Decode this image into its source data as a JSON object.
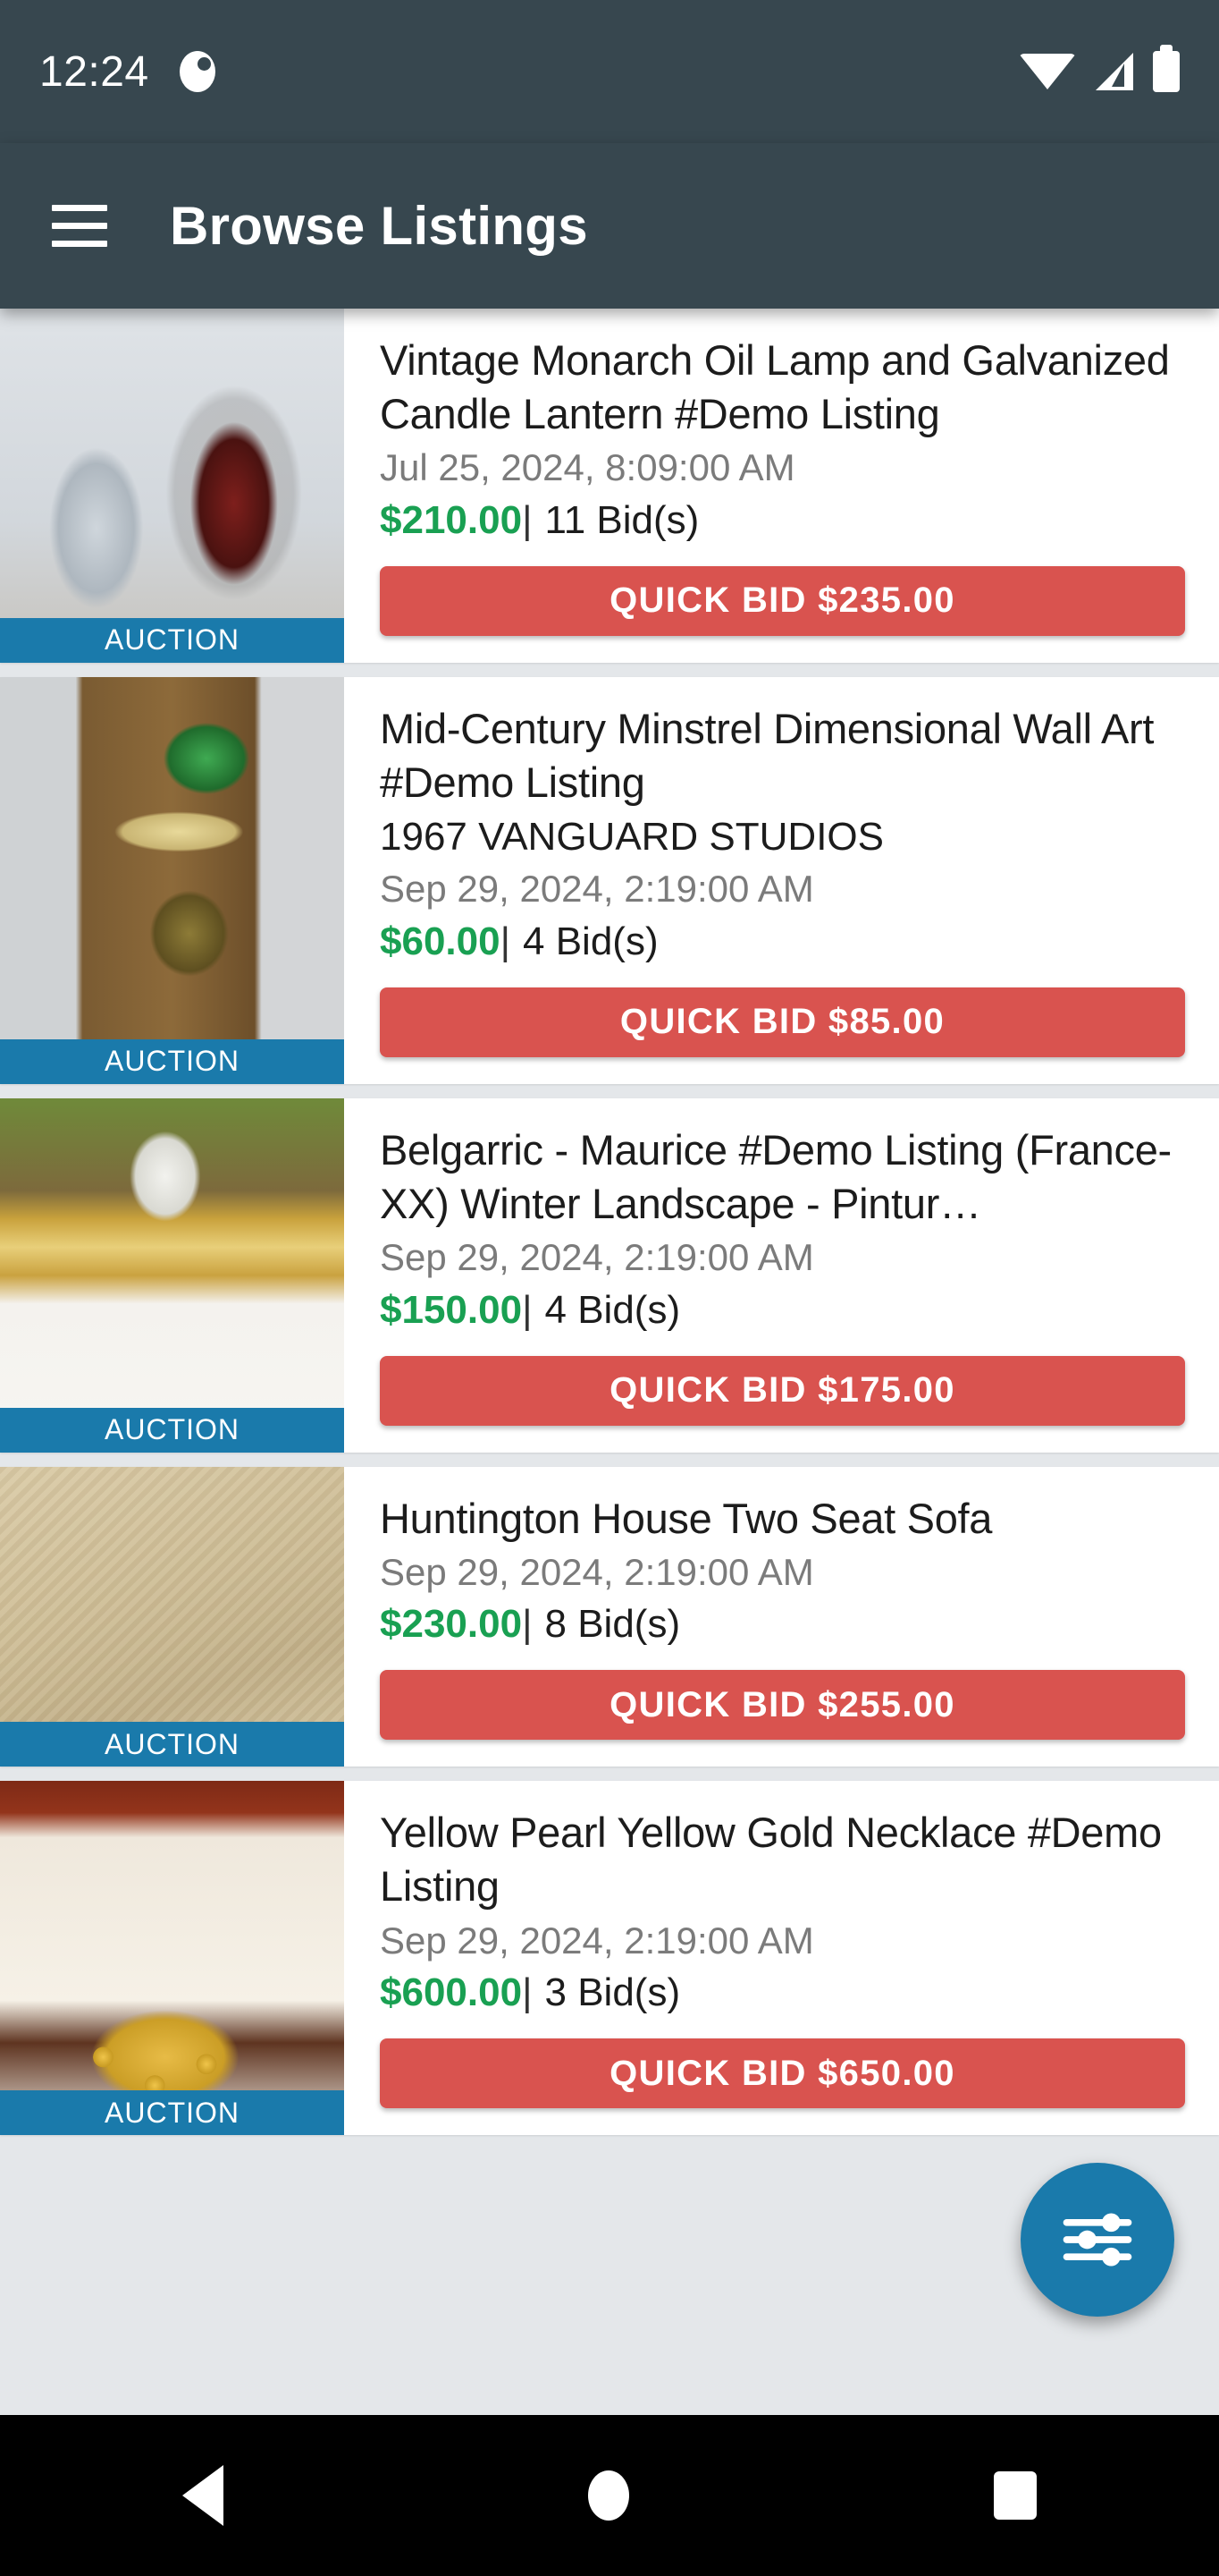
{
  "status_bar": {
    "clock": "12:24",
    "icons": [
      "notification-icon",
      "wifi-icon",
      "cell-signal-icon",
      "battery-icon"
    ]
  },
  "app_bar": {
    "menu_icon": "hamburger-menu-icon",
    "title": "Browse Listings"
  },
  "listings": [
    {
      "title": "Vintage Monarch Oil Lamp and Galvanized Candle Lantern #Demo Listing",
      "subtitle": "",
      "date": "Jul 25, 2024, 8:09:00 AM",
      "price": "$210.00",
      "separator": "|",
      "bids": "11 Bid(s)",
      "bid_button": "QUICK BID $235.00",
      "badge": "AUCTION",
      "image": "vintage-oil-lamp-photo"
    },
    {
      "title": "Mid-Century Minstrel Dimensional Wall Art #Demo Listing",
      "subtitle": "1967 VANGUARD STUDIOS",
      "date": "Sep 29, 2024, 2:19:00 AM",
      "price": "$60.00",
      "separator": "|",
      "bids": "4 Bid(s)",
      "bid_button": "QUICK BID $85.00",
      "badge": "AUCTION",
      "image": "wall-art-photo"
    },
    {
      "title": "Belgarric - Maurice #Demo Listing (France- XX) Winter Landscape - Pintur…",
      "subtitle": "",
      "date": "Sep 29, 2024, 2:19:00 AM",
      "price": "$150.00",
      "separator": "|",
      "bids": "4 Bid(s)",
      "bid_button": "QUICK BID $175.00",
      "badge": "AUCTION",
      "image": "gold-picture-frame-photo"
    },
    {
      "title": "Huntington House Two Seat Sofa",
      "subtitle": "",
      "date": "Sep 29, 2024, 2:19:00 AM",
      "price": "$230.00",
      "separator": "|",
      "bids": "8 Bid(s)",
      "bid_button": "QUICK BID $255.00",
      "badge": "AUCTION",
      "image": "beige-sofa-photo"
    },
    {
      "title": "Yellow Pearl Yellow Gold Necklace #Demo Listing",
      "subtitle": "",
      "date": "Sep 29, 2024, 2:19:00 AM",
      "price": "$600.00",
      "separator": "|",
      "bids": "3 Bid(s)",
      "bid_button": "QUICK BID $650.00",
      "badge": "AUCTION",
      "image": "pearl-necklace-photo"
    }
  ],
  "fab": {
    "icon": "filter-tune-icon"
  },
  "nav_bar": {
    "back": "back-icon",
    "home": "home-icon",
    "recents": "recents-icon"
  },
  "colors": {
    "app_bar": "#37474f",
    "badge": "#1a7aab",
    "bid_button": "#d9534f",
    "price": "#19a052",
    "fab": "#1a7aab",
    "page_background": "#e4e7ea"
  }
}
